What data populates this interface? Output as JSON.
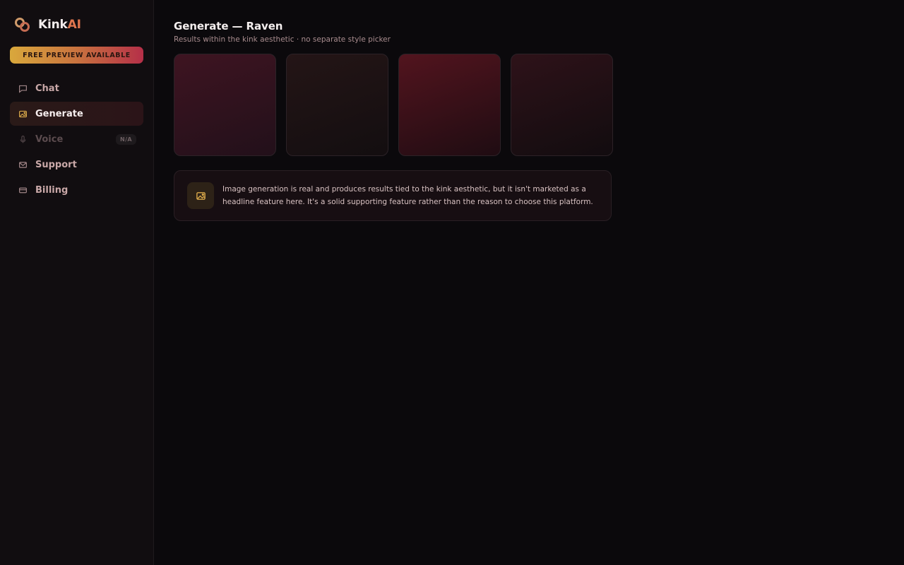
{
  "brand": {
    "name_part1": "Kink",
    "name_part2": "AI"
  },
  "promo": {
    "label": "FREE PREVIEW AVAILABLE"
  },
  "nav": {
    "items": [
      {
        "label": "Chat",
        "icon": "chat-bubble-icon"
      },
      {
        "label": "Generate",
        "icon": "image-icon",
        "active": true
      },
      {
        "label": "Voice",
        "icon": "microphone-icon",
        "disabled": true,
        "badge": "N/A"
      },
      {
        "label": "Support",
        "icon": "mail-icon"
      },
      {
        "label": "Billing",
        "icon": "card-icon"
      }
    ]
  },
  "main": {
    "title": "Generate — Raven",
    "subtitle": "Results within the kink aesthetic · no separate style picker",
    "info": "Image generation is real and produces results tied to the kink aesthetic, but it isn't marketed as a headline feature here. It's a solid supporting feature rather than the reason to choose this platform."
  },
  "colors": {
    "accent_gold": "#d9a83c",
    "accent_red": "#b52f48",
    "background": "#0b090c",
    "sidebar": "#110d10"
  }
}
